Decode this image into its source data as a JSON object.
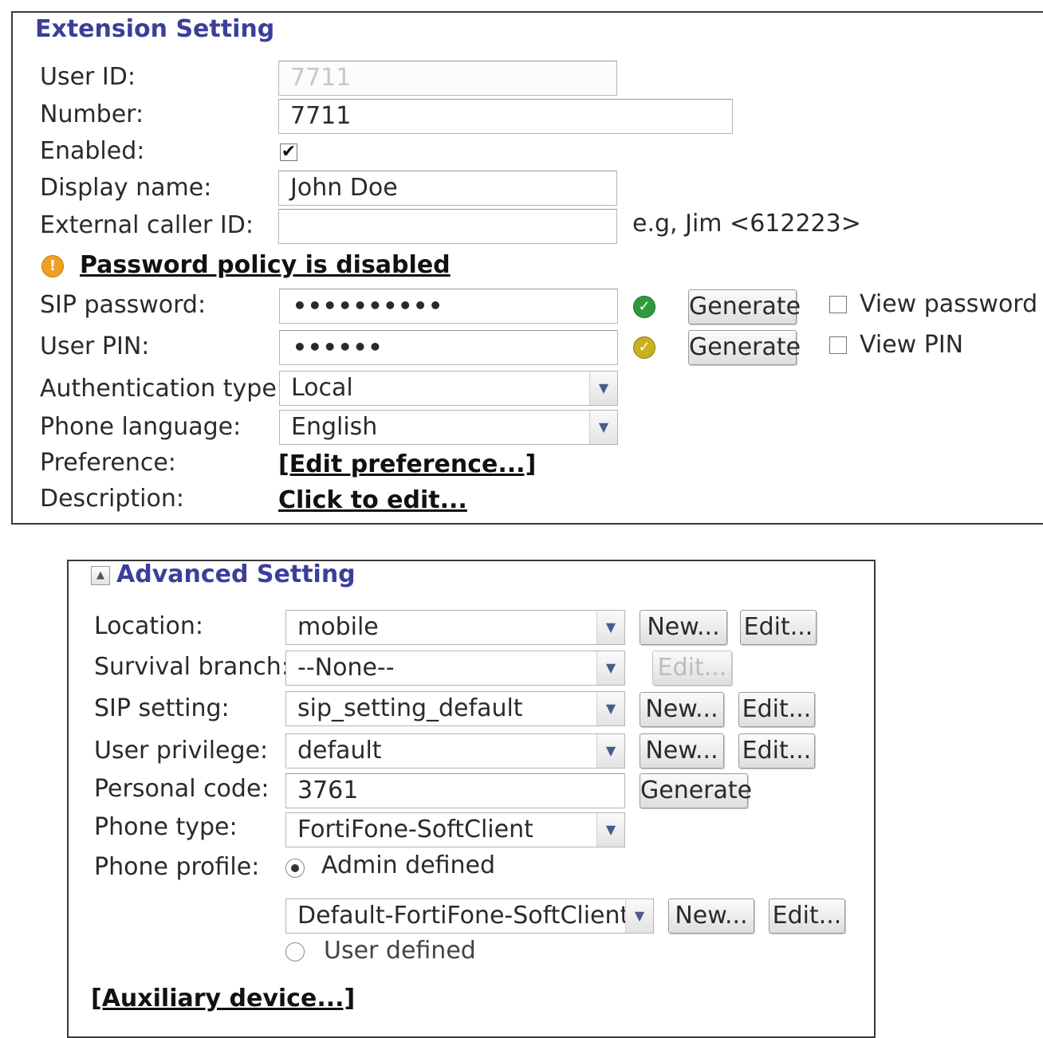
{
  "extension": {
    "legend": "Extension Setting",
    "user_id": {
      "label": "User ID:",
      "value": "7711"
    },
    "number": {
      "label": "Number:",
      "value": "7711"
    },
    "enabled": {
      "label": "Enabled:",
      "checked": true,
      "glyph": "✔"
    },
    "display_name": {
      "label": "Display name:",
      "value": "John Doe"
    },
    "external_caller_id": {
      "label": "External caller ID:",
      "value": "",
      "hint": "e.g, Jim <612223>"
    },
    "password_policy": {
      "icon": "warning-icon",
      "glyph": "!",
      "text": "Password policy is disabled"
    },
    "sip_password": {
      "label": "SIP password:",
      "value": "••••••••••",
      "status_icon": "check-icon",
      "status_color": "#2e9a3c",
      "generate_label": "Generate",
      "view_label": "View password"
    },
    "user_pin": {
      "label": "User PIN:",
      "value": "••••••",
      "status_icon": "check-icon",
      "status_color": "#c9b020",
      "generate_label": "Generate",
      "view_label": "View PIN"
    },
    "authentication_type": {
      "label": "Authentication type:",
      "value": "Local"
    },
    "phone_language": {
      "label": "Phone language:",
      "value": "English"
    },
    "preference": {
      "label": "Preference:",
      "link": "[Edit preference...]"
    },
    "description": {
      "label": "Description:",
      "link": "Click to edit..."
    }
  },
  "advanced": {
    "legend": "Advanced Setting",
    "collapse_icon": "collapse-up-icon",
    "location": {
      "label": "Location:",
      "value": "mobile",
      "new_label": "New...",
      "edit_label": "Edit..."
    },
    "survival_branch": {
      "label": "Survival branch:",
      "value": "--None--",
      "edit_label": "Edit..."
    },
    "sip_setting": {
      "label": "SIP setting:",
      "value": "sip_setting_default",
      "new_label": "New...",
      "edit_label": "Edit..."
    },
    "user_privilege": {
      "label": "User privilege:",
      "value": "default",
      "new_label": "New...",
      "edit_label": "Edit..."
    },
    "personal_code": {
      "label": "Personal code:",
      "value": "3761",
      "generate_label": "Generate"
    },
    "phone_type": {
      "label": "Phone type:",
      "value": "FortiFone-SoftClient"
    },
    "phone_profile": {
      "label": "Phone profile:",
      "admin_defined": "Admin defined",
      "profile_value": "Default-FortiFone-SoftClient",
      "new_label": "New...",
      "edit_label": "Edit...",
      "user_defined": "User defined",
      "selected": "admin_defined"
    },
    "auxiliary_device": "[Auxiliary device...]"
  },
  "colors": {
    "legend": "#3a3f9a",
    "sip_ok": "#2e9a3c",
    "pin_ok": "#c9b020",
    "warning": "#f0a020"
  }
}
